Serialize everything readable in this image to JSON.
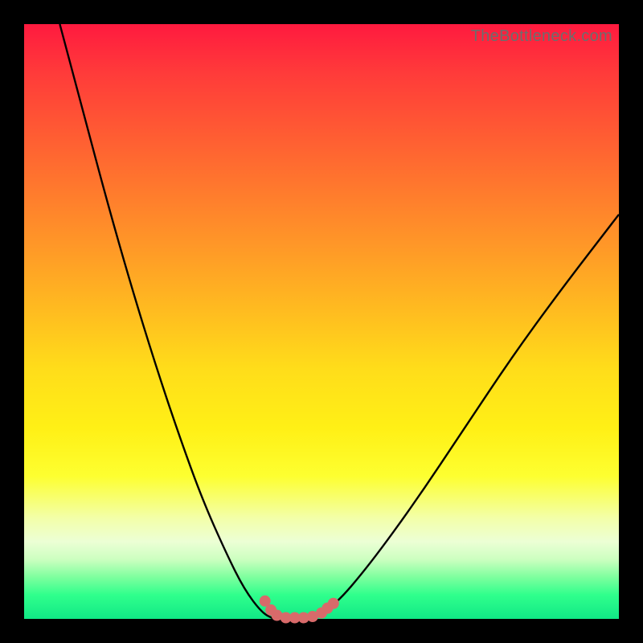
{
  "watermark": "TheBottleneck.com",
  "colors": {
    "frame": "#000000",
    "marker": "#d86a6a",
    "line": "#000000"
  },
  "chart_data": {
    "type": "line",
    "title": "",
    "xlabel": "",
    "ylabel": "",
    "xlim": [
      0,
      100
    ],
    "ylim": [
      0,
      100
    ],
    "grid": false,
    "series": [
      {
        "name": "bottleneck-curve-left",
        "x": [
          6,
          10,
          14,
          18,
          22,
          26,
          30,
          34,
          37,
          40,
          42
        ],
        "values": [
          100,
          85,
          70,
          56,
          43,
          31,
          20,
          11,
          5,
          1,
          0
        ]
      },
      {
        "name": "bottleneck-curve-right",
        "x": [
          48,
          52,
          58,
          66,
          74,
          82,
          90,
          100
        ],
        "values": [
          0,
          2,
          9,
          20,
          32,
          44,
          55,
          68
        ]
      }
    ],
    "markers": {
      "name": "optimal-zone-dots",
      "color": "#d86a6a",
      "points": [
        {
          "x": 40.5,
          "y": 3.0
        },
        {
          "x": 41.5,
          "y": 1.5
        },
        {
          "x": 42.5,
          "y": 0.6
        },
        {
          "x": 44.0,
          "y": 0.2
        },
        {
          "x": 45.5,
          "y": 0.2
        },
        {
          "x": 47.0,
          "y": 0.2
        },
        {
          "x": 48.5,
          "y": 0.4
        },
        {
          "x": 50.0,
          "y": 1.0
        },
        {
          "x": 51.0,
          "y": 1.8
        },
        {
          "x": 52.0,
          "y": 2.6
        }
      ]
    }
  }
}
